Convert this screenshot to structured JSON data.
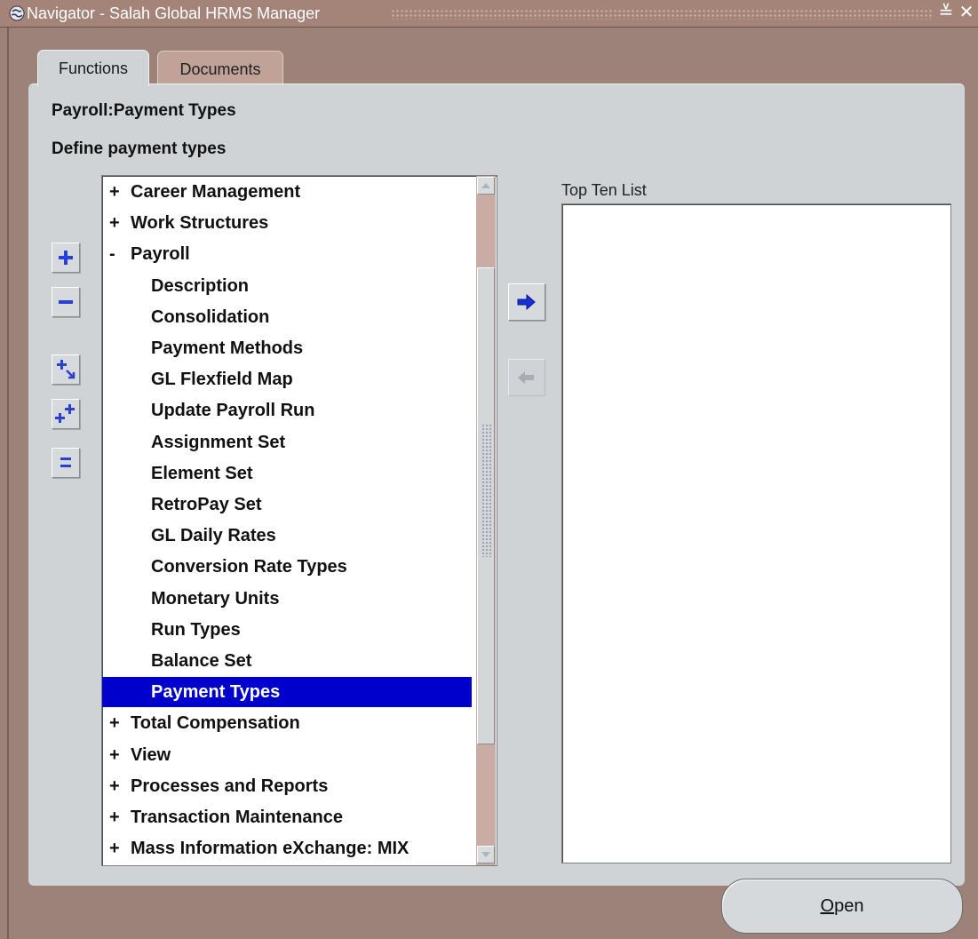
{
  "window": {
    "title": "Navigator - Salah Global HRMS Manager",
    "minimize_glyph": "≚",
    "close_glyph": "✕"
  },
  "tabs": [
    {
      "label": "Functions",
      "active": true
    },
    {
      "label": "Documents",
      "active": false
    }
  ],
  "headings": {
    "function_name": "Payroll:Payment Types",
    "function_description": "Define payment types"
  },
  "left_toolbar": [
    {
      "name": "expand-icon"
    },
    {
      "name": "collapse-icon"
    },
    {
      "name": "expand-branch-icon"
    },
    {
      "name": "expand-all-icon"
    },
    {
      "name": "collapse-all-icon"
    }
  ],
  "tree": {
    "items": [
      {
        "exp": "+",
        "label": "Career Management",
        "level": 0
      },
      {
        "exp": "+",
        "label": "Work Structures",
        "level": 0
      },
      {
        "exp": "-",
        "label": "Payroll",
        "level": 0
      },
      {
        "exp": "",
        "label": "Description",
        "level": 1
      },
      {
        "exp": "",
        "label": "Consolidation",
        "level": 1
      },
      {
        "exp": "",
        "label": "Payment Methods",
        "level": 1
      },
      {
        "exp": "",
        "label": "GL Flexfield Map",
        "level": 1
      },
      {
        "exp": "",
        "label": "Update Payroll Run",
        "level": 1
      },
      {
        "exp": "",
        "label": "Assignment Set",
        "level": 1
      },
      {
        "exp": "",
        "label": "Element Set",
        "level": 1
      },
      {
        "exp": "",
        "label": "RetroPay Set",
        "level": 1
      },
      {
        "exp": "",
        "label": "GL Daily Rates",
        "level": 1
      },
      {
        "exp": "",
        "label": "Conversion Rate Types",
        "level": 1
      },
      {
        "exp": "",
        "label": "Monetary Units",
        "level": 1
      },
      {
        "exp": "",
        "label": "Run Types",
        "level": 1
      },
      {
        "exp": "",
        "label": "Balance Set",
        "level": 1
      },
      {
        "exp": "",
        "label": "Payment Types",
        "level": 1,
        "selected": true
      },
      {
        "exp": "+",
        "label": "Total Compensation",
        "level": 0
      },
      {
        "exp": "+",
        "label": "View",
        "level": 0
      },
      {
        "exp": "+",
        "label": "Processes and Reports",
        "level": 0
      },
      {
        "exp": "+",
        "label": "Transaction Maintenance",
        "level": 0
      },
      {
        "exp": "+",
        "label": "Mass Information eXchange: MIX",
        "level": 0
      }
    ]
  },
  "top_ten": {
    "label": "Top Ten List",
    "items": []
  },
  "buttons": {
    "open_mnemonic": "O",
    "open_rest": "pen"
  },
  "colors": {
    "selection": "#0000cc",
    "frame": "#9c8278",
    "panel": "#cfd3d6"
  }
}
